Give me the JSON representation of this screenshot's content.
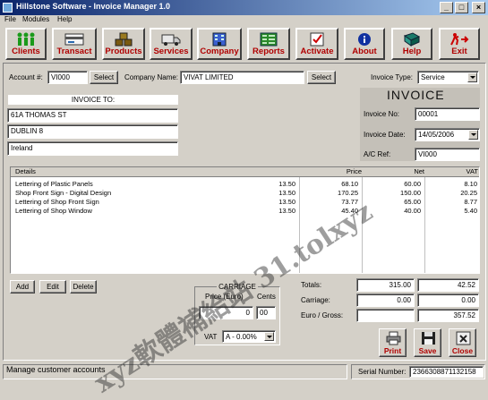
{
  "window": {
    "title": "Hillstone Software - Invoice Manager 1.0"
  },
  "menu": {
    "file": "File",
    "modules": "Modules",
    "help": "Help"
  },
  "toolbar": {
    "clients": "Clients",
    "transact": "Transact",
    "products": "Products",
    "services": "Services",
    "company": "Company",
    "reports": "Reports",
    "activate": "Activate",
    "about": "About",
    "help": "Help",
    "exit": "Exit"
  },
  "account": {
    "label": "Account #:",
    "value": "VI000",
    "select": "Select"
  },
  "company": {
    "label": "Company Name:",
    "value": "VIVAT LIMITED",
    "select": "Select"
  },
  "invoice_type": {
    "label": "Invoice Type:",
    "value": "Service"
  },
  "invoice_to": {
    "title": "INVOICE TO:",
    "line1": "61A THOMAS ST",
    "line2": "DUBLIN 8",
    "line3": "Ireland"
  },
  "invoice": {
    "heading": "INVOICE",
    "no_label": "Invoice No:",
    "no_value": "00001",
    "date_label": "Invoice Date:",
    "date_value": "14/05/2006",
    "ref_label": "A/C Ref:",
    "ref_value": "VI000"
  },
  "grid": {
    "headers": {
      "details": "Details",
      "price": "Price",
      "net": "Net",
      "vat": "VAT"
    },
    "rows": [
      {
        "details": "Lettering of Plastic Panels",
        "qty": "13.50",
        "price": "68.10",
        "net": "60.00",
        "vat": "8.10"
      },
      {
        "details": "Shop Front Sign - Digital Design",
        "qty": "13.50",
        "price": "170.25",
        "net": "150.00",
        "vat": "20.25"
      },
      {
        "details": "Lettering of Shop Front Sign",
        "qty": "13.50",
        "price": "73.77",
        "net": "65.00",
        "vat": "8.77"
      },
      {
        "details": "Lettering of Shop Window",
        "qty": "13.50",
        "price": "45.40",
        "net": "40.00",
        "vat": "5.40"
      }
    ]
  },
  "row_buttons": {
    "add": "Add",
    "edit": "Edit",
    "delete": "Delete"
  },
  "carriage": {
    "title": "CARRIAGE",
    "price_label": "Price (Euro)",
    "cents_label": "Cents",
    "price_value": "0",
    "cents_value": "00",
    "vat_label": "VAT",
    "vat_value": "A - 0.00%"
  },
  "totals": {
    "totals_label": "Totals:",
    "totals_net": "315.00",
    "totals_vat": "42.52",
    "carriage_label": "Carriage:",
    "carriage_net": "0.00",
    "carriage_vat": "0.00",
    "gross_label": "Euro / Gross:",
    "gross_value": "357.52"
  },
  "actions": {
    "print": "Print",
    "save": "Save",
    "close": "Close"
  },
  "status": {
    "message": "Manage customer accounts",
    "serial_label": "Serial Number:",
    "serial_value": "2366308871132158"
  },
  "watermark": "xyz軟體補給站 31.tolxyz"
}
